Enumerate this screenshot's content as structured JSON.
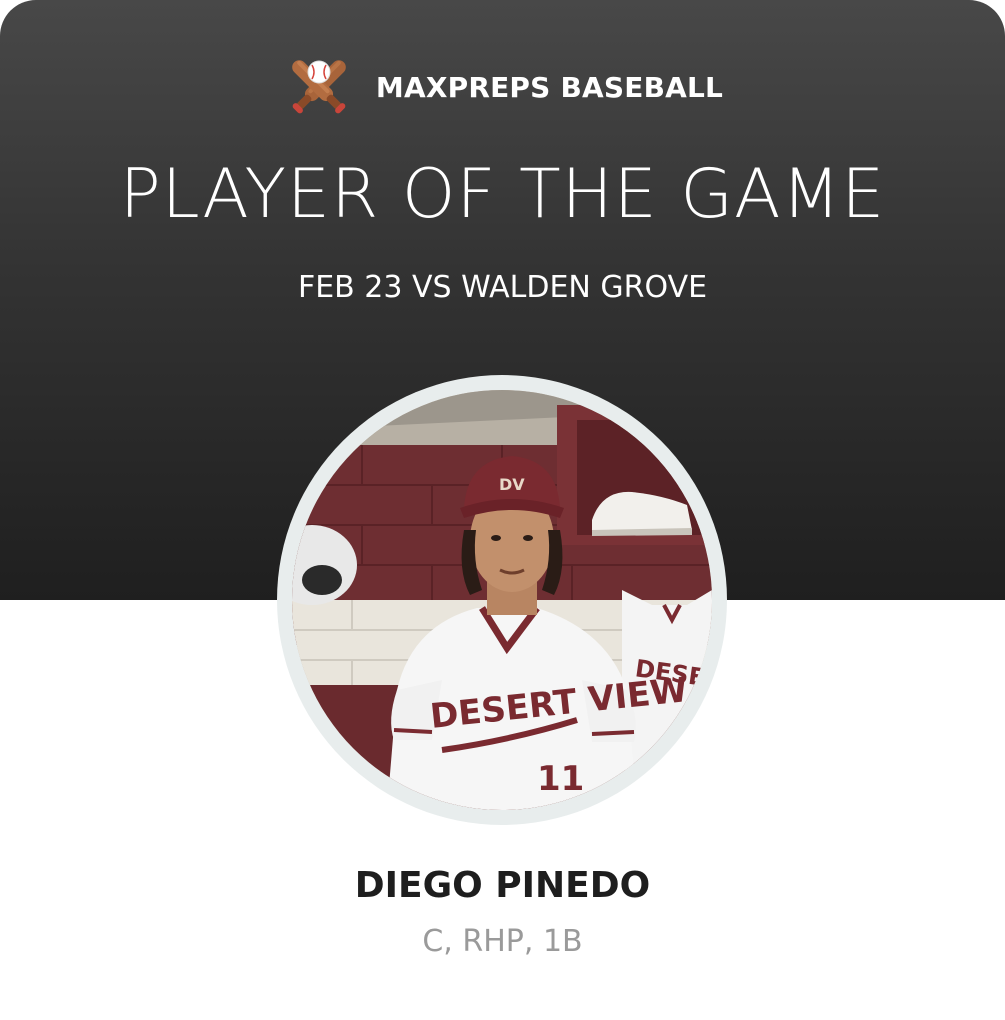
{
  "brand": {
    "icon": "crossed-bats-baseball-icon",
    "label": "MAXPREPS BASEBALL"
  },
  "title": "PLAYER OF THE GAME",
  "subtitle": "FEB 23 VS WALDEN GROVE",
  "player": {
    "name": "DIEGO PINEDO",
    "positions": "C, RHP, 1B",
    "jersey_text": "DESERT VIEW",
    "jersey_number": "11",
    "cap_logo": "DV"
  },
  "colors": {
    "hero_dark": "#333333",
    "maroon": "#7a2a30",
    "name_text": "#1e1e1e",
    "positions_text": "#9a9a9a"
  }
}
